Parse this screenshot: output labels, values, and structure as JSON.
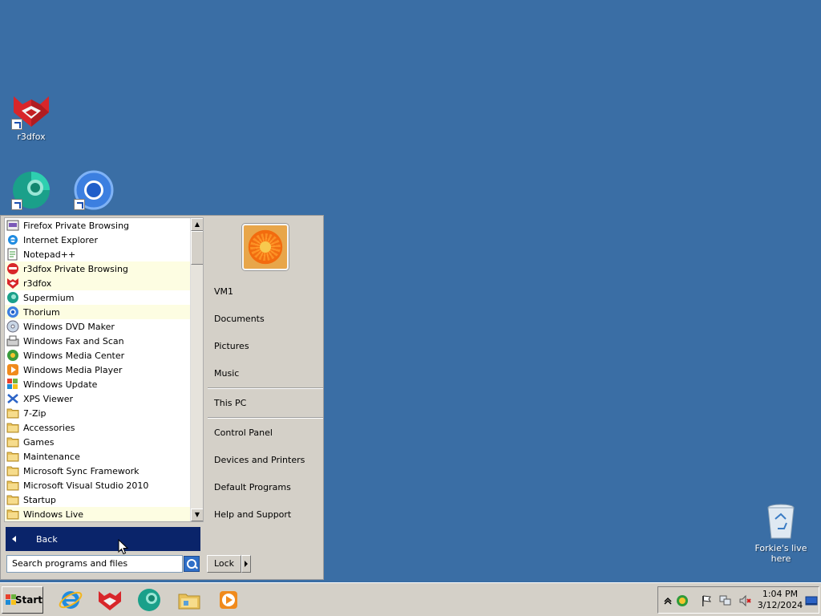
{
  "desktop": {
    "icons": [
      {
        "label": "r3dfox"
      },
      {
        "label": ""
      },
      {
        "label": ""
      },
      {
        "label": "Forkie's live here"
      }
    ]
  },
  "start_menu": {
    "programs": [
      {
        "label": "Firefox Private Browsing",
        "icon": "firefox-private-icon",
        "highlight": false
      },
      {
        "label": "Internet Explorer",
        "icon": "internet-explorer-icon",
        "highlight": false
      },
      {
        "label": "Notepad++",
        "icon": "notepad-plus-plus-icon",
        "highlight": false
      },
      {
        "label": "r3dfox Private Browsing",
        "icon": "r3dfox-private-icon",
        "highlight": true
      },
      {
        "label": "r3dfox",
        "icon": "r3dfox-icon",
        "highlight": true
      },
      {
        "label": "Supermium",
        "icon": "supermium-icon",
        "highlight": false
      },
      {
        "label": "Thorium",
        "icon": "thorium-icon",
        "highlight": true
      },
      {
        "label": "Windows DVD Maker",
        "icon": "dvd-maker-icon",
        "highlight": false
      },
      {
        "label": "Windows Fax and Scan",
        "icon": "fax-scan-icon",
        "highlight": false
      },
      {
        "label": "Windows Media Center",
        "icon": "media-center-icon",
        "highlight": false
      },
      {
        "label": "Windows Media Player",
        "icon": "media-player-icon",
        "highlight": false
      },
      {
        "label": "Windows Update",
        "icon": "windows-update-icon",
        "highlight": false
      },
      {
        "label": "XPS Viewer",
        "icon": "xps-viewer-icon",
        "highlight": false
      },
      {
        "label": "7-Zip",
        "icon": "folder-icon",
        "highlight": false
      },
      {
        "label": "Accessories",
        "icon": "folder-icon",
        "highlight": false
      },
      {
        "label": "Games",
        "icon": "folder-icon",
        "highlight": false
      },
      {
        "label": "Maintenance",
        "icon": "folder-icon",
        "highlight": false
      },
      {
        "label": "Microsoft Sync Framework",
        "icon": "folder-icon",
        "highlight": false
      },
      {
        "label": "Microsoft Visual Studio 2010",
        "icon": "folder-icon",
        "highlight": false
      },
      {
        "label": "Startup",
        "icon": "folder-icon",
        "highlight": false
      },
      {
        "label": "Windows Live",
        "icon": "folder-icon",
        "highlight": true
      }
    ],
    "back_label": "Back",
    "search_placeholder": "Search programs and files",
    "right_items": {
      "user": "VM1",
      "documents": "Documents",
      "pictures": "Pictures",
      "music": "Music",
      "this_pc": "This PC",
      "control_panel": "Control Panel",
      "devices": "Devices and Printers",
      "default_programs": "Default Programs",
      "help": "Help and Support"
    },
    "lock_label": "Lock"
  },
  "taskbar": {
    "start_label": "Start",
    "pinned": [
      "internet-explorer-icon",
      "r3dfox-icon",
      "supermium-icon",
      "file-explorer-icon",
      "media-player-icon"
    ],
    "clock": {
      "time": "1:04 PM",
      "date": "3/12/2024"
    }
  },
  "colors": {
    "desktop": "#3a6ea5",
    "selection": "#0a246a",
    "highlight": "#fdfde2",
    "menu_bg": "#d4d0c8"
  }
}
